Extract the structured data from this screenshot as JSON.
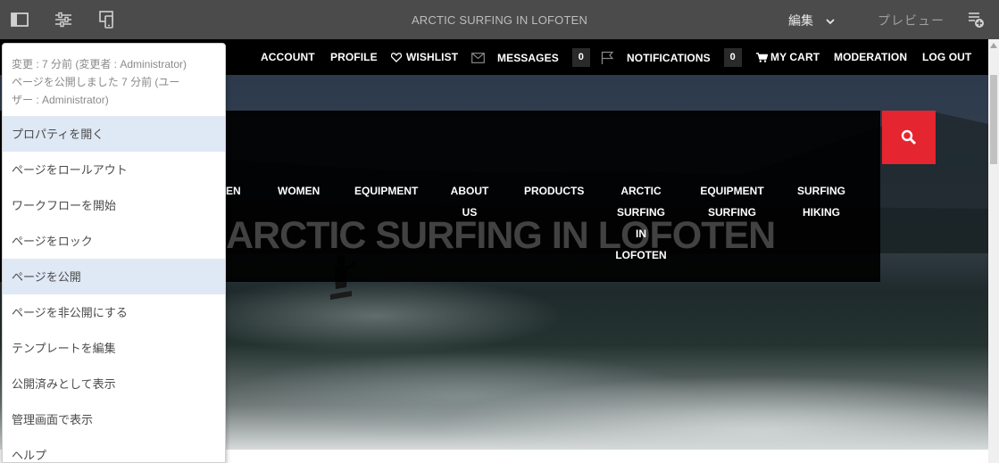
{
  "editor": {
    "title": "ARCTIC SURFING IN LOFOTEN",
    "mode": "編集",
    "preview": "プレビュー",
    "icons": [
      "side-panel-icon",
      "page-information-icon",
      "emulator-icon",
      "annotate-icon",
      "chevron-down-icon"
    ]
  },
  "site_nav": {
    "items": [
      "ACCOUNT",
      "PROFILE",
      "WISHLIST",
      "MESSAGES",
      "NOTIFICATIONS",
      "MY CART",
      "MODERATION",
      "LOG OUT"
    ],
    "messages_count": "0",
    "notifications_count": "0"
  },
  "categories": {
    "men": "EN",
    "women": "WOMEN",
    "equipment": "EQUIPMENT",
    "about_1": "ABOUT",
    "about_2": "US",
    "products": "PRODUCTS",
    "arctic_1": "ARCTIC",
    "arctic_2": "SURFING",
    "arctic_3": "IN",
    "arctic_4": "LOFOTEN",
    "eqs_1": "EQUIPMENT",
    "eqs_2": "SURFING",
    "sh_1": "SURFING",
    "sh_2": "HIKING"
  },
  "hero": {
    "title": "ARCTIC SURFING IN LOFOTEN"
  },
  "popover": {
    "modified_line": "変更 : 7 分前 (変更者 : Administrator)",
    "published_line_1": "ページを公開しました 7 分前 (ユー",
    "published_line_2": "ザー : Administrator)",
    "items": [
      "プロパティを開く",
      "ページをロールアウト",
      "ワークフローを開始",
      "ページをロック",
      "ページを公開",
      "ページを非公開にする",
      "テンプレートを編集",
      "公開済みとして表示",
      "管理画面で表示",
      "ヘルプ"
    ]
  },
  "colors": {
    "toolbar": "#4b4b4b",
    "search_accent": "#e5252f",
    "highlight": "#dfe8f5"
  }
}
